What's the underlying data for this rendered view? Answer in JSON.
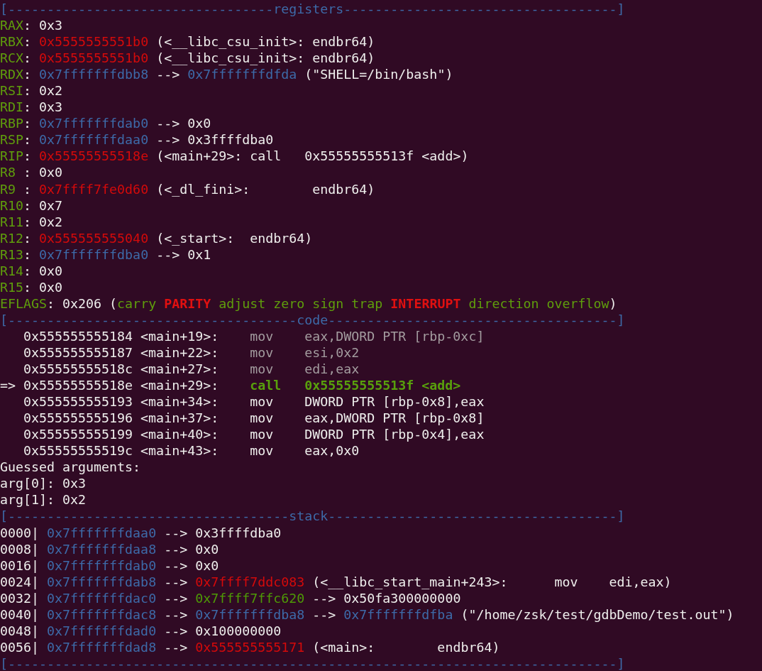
{
  "lines": [
    [
      {
        "text": "[----------------------------------",
        "kind": "header"
      },
      {
        "text": "registers",
        "kind": "header"
      },
      {
        "text": "-----------------------------------]",
        "kind": "header"
      }
    ],
    [
      {
        "text": "RAX",
        "kind": "label"
      },
      {
        "text": ": 0x3",
        "kind": "plain"
      }
    ],
    [
      {
        "text": "RBX",
        "kind": "label"
      },
      {
        "text": ": ",
        "kind": "plain"
      },
      {
        "text": "0x5555555551b0",
        "kind": "code"
      },
      {
        "text": " (<__libc_csu_init>: endbr64)",
        "kind": "plain"
      }
    ],
    [
      {
        "text": "RCX",
        "kind": "label"
      },
      {
        "text": ": ",
        "kind": "plain"
      },
      {
        "text": "0x5555555551b0",
        "kind": "code"
      },
      {
        "text": " (<__libc_csu_init>: endbr64)",
        "kind": "plain"
      }
    ],
    [
      {
        "text": "RDX",
        "kind": "label"
      },
      {
        "text": ": ",
        "kind": "plain"
      },
      {
        "text": "0x7fffffffdbb8",
        "kind": "stack"
      },
      {
        "text": " --> ",
        "kind": "plain"
      },
      {
        "text": "0x7fffffffdfda",
        "kind": "stack"
      },
      {
        "text": " (\"SHELL=/bin/bash\")",
        "kind": "plain"
      }
    ],
    [
      {
        "text": "RSI",
        "kind": "label"
      },
      {
        "text": ": 0x2",
        "kind": "plain"
      }
    ],
    [
      {
        "text": "RDI",
        "kind": "label"
      },
      {
        "text": ": 0x3",
        "kind": "plain"
      }
    ],
    [
      {
        "text": "RBP",
        "kind": "label"
      },
      {
        "text": ": ",
        "kind": "plain"
      },
      {
        "text": "0x7fffffffdab0",
        "kind": "stack"
      },
      {
        "text": " --> 0x0",
        "kind": "plain"
      }
    ],
    [
      {
        "text": "RSP",
        "kind": "label"
      },
      {
        "text": ": ",
        "kind": "plain"
      },
      {
        "text": "0x7fffffffdaa0",
        "kind": "stack"
      },
      {
        "text": " --> 0x3ffffdba0",
        "kind": "plain"
      }
    ],
    [
      {
        "text": "RIP",
        "kind": "label"
      },
      {
        "text": ": ",
        "kind": "plain"
      },
      {
        "text": "0x55555555518e",
        "kind": "code"
      },
      {
        "text": " (<main+29>: call   0x55555555513f <add>)",
        "kind": "plain"
      }
    ],
    [
      {
        "text": "R8 ",
        "kind": "label"
      },
      {
        "text": ": 0x0",
        "kind": "plain"
      }
    ],
    [
      {
        "text": "R9 ",
        "kind": "label"
      },
      {
        "text": ": ",
        "kind": "plain"
      },
      {
        "text": "0x7ffff7fe0d60",
        "kind": "code"
      },
      {
        "text": " (<_dl_fini>:        endbr64)",
        "kind": "plain"
      }
    ],
    [
      {
        "text": "R10",
        "kind": "label"
      },
      {
        "text": ": 0x7",
        "kind": "plain"
      }
    ],
    [
      {
        "text": "R11",
        "kind": "label"
      },
      {
        "text": ": 0x2",
        "kind": "plain"
      }
    ],
    [
      {
        "text": "R12",
        "kind": "label"
      },
      {
        "text": ": ",
        "kind": "plain"
      },
      {
        "text": "0x555555555040",
        "kind": "code"
      },
      {
        "text": " (<_start>:  endbr64)",
        "kind": "plain"
      }
    ],
    [
      {
        "text": "R13",
        "kind": "label"
      },
      {
        "text": ": ",
        "kind": "plain"
      },
      {
        "text": "0x7fffffffdba0",
        "kind": "stack"
      },
      {
        "text": " --> 0x1",
        "kind": "plain"
      }
    ],
    [
      {
        "text": "R14",
        "kind": "label"
      },
      {
        "text": ": 0x0",
        "kind": "plain"
      }
    ],
    [
      {
        "text": "R15",
        "kind": "label"
      },
      {
        "text": ": 0x0",
        "kind": "plain"
      }
    ],
    [
      {
        "text": "EFLAGS",
        "kind": "label"
      },
      {
        "text": ": 0x206 (",
        "kind": "plain"
      },
      {
        "text": "carry ",
        "kind": "label"
      },
      {
        "text": "PARITY",
        "kind": "flag"
      },
      {
        "text": " adjust zero sign trap ",
        "kind": "label"
      },
      {
        "text": "INTERRUPT",
        "kind": "flag"
      },
      {
        "text": " direction overflow",
        "kind": "label"
      },
      {
        "text": ")",
        "kind": "plain"
      }
    ],
    [
      {
        "text": "[-------------------------------------",
        "kind": "header"
      },
      {
        "text": "code",
        "kind": "header"
      },
      {
        "text": "-------------------------------------]",
        "kind": "header"
      }
    ],
    [
      {
        "text": "   0x555555555184 <main+19>:    ",
        "kind": "plain"
      },
      {
        "text": "mov    eax,DWORD PTR [rbp-0xc]",
        "kind": "dim"
      }
    ],
    [
      {
        "text": "   0x555555555187 <main+22>:    ",
        "kind": "plain"
      },
      {
        "text": "mov    esi,0x2",
        "kind": "dim"
      }
    ],
    [
      {
        "text": "   0x55555555518c <main+27>:    ",
        "kind": "plain"
      },
      {
        "text": "mov    edi,eax",
        "kind": "dim"
      }
    ],
    [
      {
        "text": "=> 0x55555555518e <main+29>:    ",
        "kind": "plain"
      },
      {
        "text": "call   0x55555555513f <add>",
        "kind": "current"
      }
    ],
    [
      {
        "text": "   0x555555555193 <main+34>:    mov    DWORD PTR [rbp-0x8],eax",
        "kind": "plain"
      }
    ],
    [
      {
        "text": "   0x555555555196 <main+37>:    mov    eax,DWORD PTR [rbp-0x8]",
        "kind": "plain"
      }
    ],
    [
      {
        "text": "   0x555555555199 <main+40>:    mov    DWORD PTR [rbp-0x4],eax",
        "kind": "plain"
      }
    ],
    [
      {
        "text": "   0x55555555519c <main+43>:    mov    eax,0x0",
        "kind": "plain"
      }
    ],
    [
      {
        "text": "Guessed arguments:",
        "kind": "plain"
      }
    ],
    [
      {
        "text": "arg[0]: 0x3",
        "kind": "plain"
      }
    ],
    [
      {
        "text": "arg[1]: 0x2",
        "kind": "plain"
      }
    ],
    [
      {
        "text": "[------------------------------------",
        "kind": "header"
      },
      {
        "text": "stack",
        "kind": "header"
      },
      {
        "text": "-------------------------------------]",
        "kind": "header"
      }
    ],
    [
      {
        "text": "0000| ",
        "kind": "plain"
      },
      {
        "text": "0x7fffffffdaa0",
        "kind": "stack"
      },
      {
        "text": " --> 0x3ffffdba0",
        "kind": "plain"
      }
    ],
    [
      {
        "text": "0008| ",
        "kind": "plain"
      },
      {
        "text": "0x7fffffffdaa8",
        "kind": "stack"
      },
      {
        "text": " --> 0x0",
        "kind": "plain"
      }
    ],
    [
      {
        "text": "0016| ",
        "kind": "plain"
      },
      {
        "text": "0x7fffffffdab0",
        "kind": "stack"
      },
      {
        "text": " --> 0x0",
        "kind": "plain"
      }
    ],
    [
      {
        "text": "0024| ",
        "kind": "plain"
      },
      {
        "text": "0x7fffffffdab8",
        "kind": "stack"
      },
      {
        "text": " --> ",
        "kind": "plain"
      },
      {
        "text": "0x7ffff7ddc083",
        "kind": "code"
      },
      {
        "text": " (<__libc_start_main+243>:      mov    edi,eax)",
        "kind": "plain"
      }
    ],
    [
      {
        "text": "0032| ",
        "kind": "plain"
      },
      {
        "text": "0x7fffffffdac0",
        "kind": "stack"
      },
      {
        "text": " --> ",
        "kind": "plain"
      },
      {
        "text": "0x7ffff7ffc620",
        "kind": "data"
      },
      {
        "text": " --> 0x50fa300000000",
        "kind": "plain"
      }
    ],
    [
      {
        "text": "0040| ",
        "kind": "plain"
      },
      {
        "text": "0x7fffffffdac8",
        "kind": "stack"
      },
      {
        "text": " --> ",
        "kind": "plain"
      },
      {
        "text": "0x7fffffffdba8",
        "kind": "stack"
      },
      {
        "text": " --> ",
        "kind": "plain"
      },
      {
        "text": "0x7fffffffdfba",
        "kind": "stack"
      },
      {
        "text": " (\"/home/zsk/test/gdbDemo/test.out\")",
        "kind": "plain"
      }
    ],
    [
      {
        "text": "0048| ",
        "kind": "plain"
      },
      {
        "text": "0x7fffffffdad0",
        "kind": "stack"
      },
      {
        "text": " --> 0x100000000",
        "kind": "plain"
      }
    ],
    [
      {
        "text": "0056| ",
        "kind": "plain"
      },
      {
        "text": "0x7fffffffdad8",
        "kind": "stack"
      },
      {
        "text": " --> ",
        "kind": "plain"
      },
      {
        "text": "0x555555555171",
        "kind": "code"
      },
      {
        "text": " (<main>:        endbr64)",
        "kind": "plain"
      }
    ],
    [
      {
        "text": "[------------------------------------------------------------------------------]",
        "kind": "header"
      }
    ]
  ]
}
